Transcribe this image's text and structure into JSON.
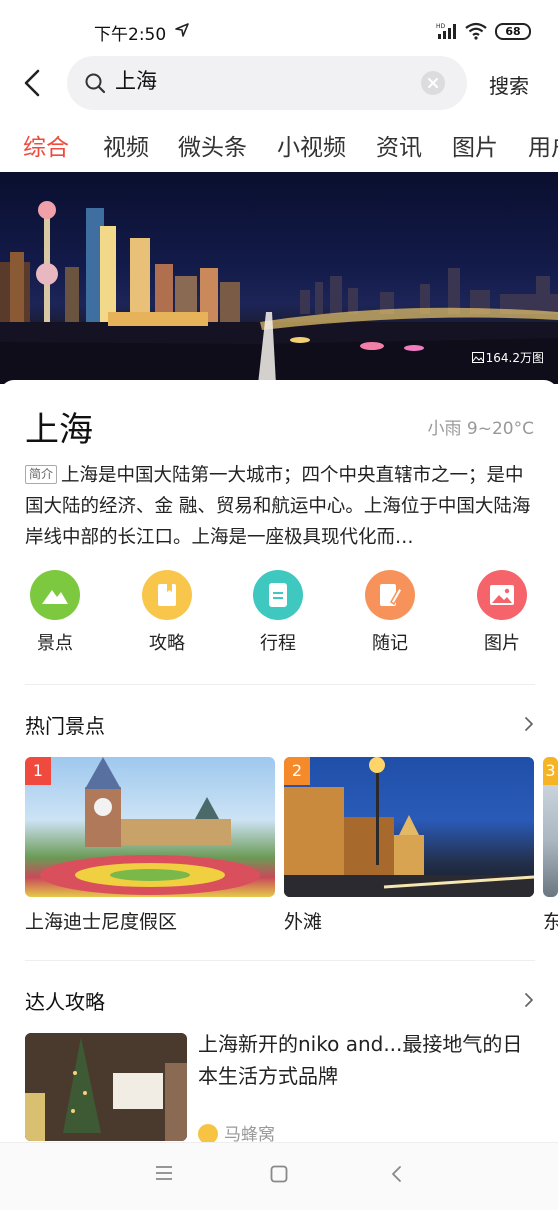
{
  "status_bar": {
    "time": "下午2:50",
    "battery": "68",
    "network": "HD"
  },
  "search": {
    "query": "上海",
    "button_label": "搜索"
  },
  "tabs": [
    {
      "label": "综合",
      "active": true
    },
    {
      "label": "视频"
    },
    {
      "label": "微头条"
    },
    {
      "label": "小视频"
    },
    {
      "label": "资讯"
    },
    {
      "label": "图片"
    },
    {
      "label": "用户"
    }
  ],
  "hero": {
    "image_count": "164.2万图"
  },
  "city": {
    "name": "上海",
    "weather": "小雨 9~20°C",
    "intro_tag": "简介",
    "intro_text": "上海是中国大陆第一大城市；四个中央直辖市之一；是中国大陆的经济、金 融、贸易和航运中心。上海位于中国大陆海岸线中部的长江口。上海是一座极具现代化而…"
  },
  "quick_links": [
    {
      "label": "景点",
      "icon": "mountain-icon",
      "color": "#7cc83f"
    },
    {
      "label": "攻略",
      "icon": "book-icon",
      "color": "#f8c64b"
    },
    {
      "label": "行程",
      "icon": "document-icon",
      "color": "#3ec8c0"
    },
    {
      "label": "随记",
      "icon": "note-pen-icon",
      "color": "#f7935a"
    },
    {
      "label": "图片",
      "icon": "picture-icon",
      "color": "#f4646a"
    }
  ],
  "hot_spots": {
    "title": "热门景点",
    "items": [
      {
        "rank": "1",
        "name": "上海迪士尼度假区",
        "rank_color": "#f04a3e"
      },
      {
        "rank": "2",
        "name": "外滩",
        "rank_color": "#f58a2b"
      },
      {
        "rank": "3",
        "name": "东",
        "rank_color": "#f6b424"
      }
    ]
  },
  "guides": {
    "title": "达人攻略",
    "items": [
      {
        "title": "上海新开的niko and...最接地气的日本生活方式品牌",
        "source": "马蜂窝"
      }
    ]
  }
}
